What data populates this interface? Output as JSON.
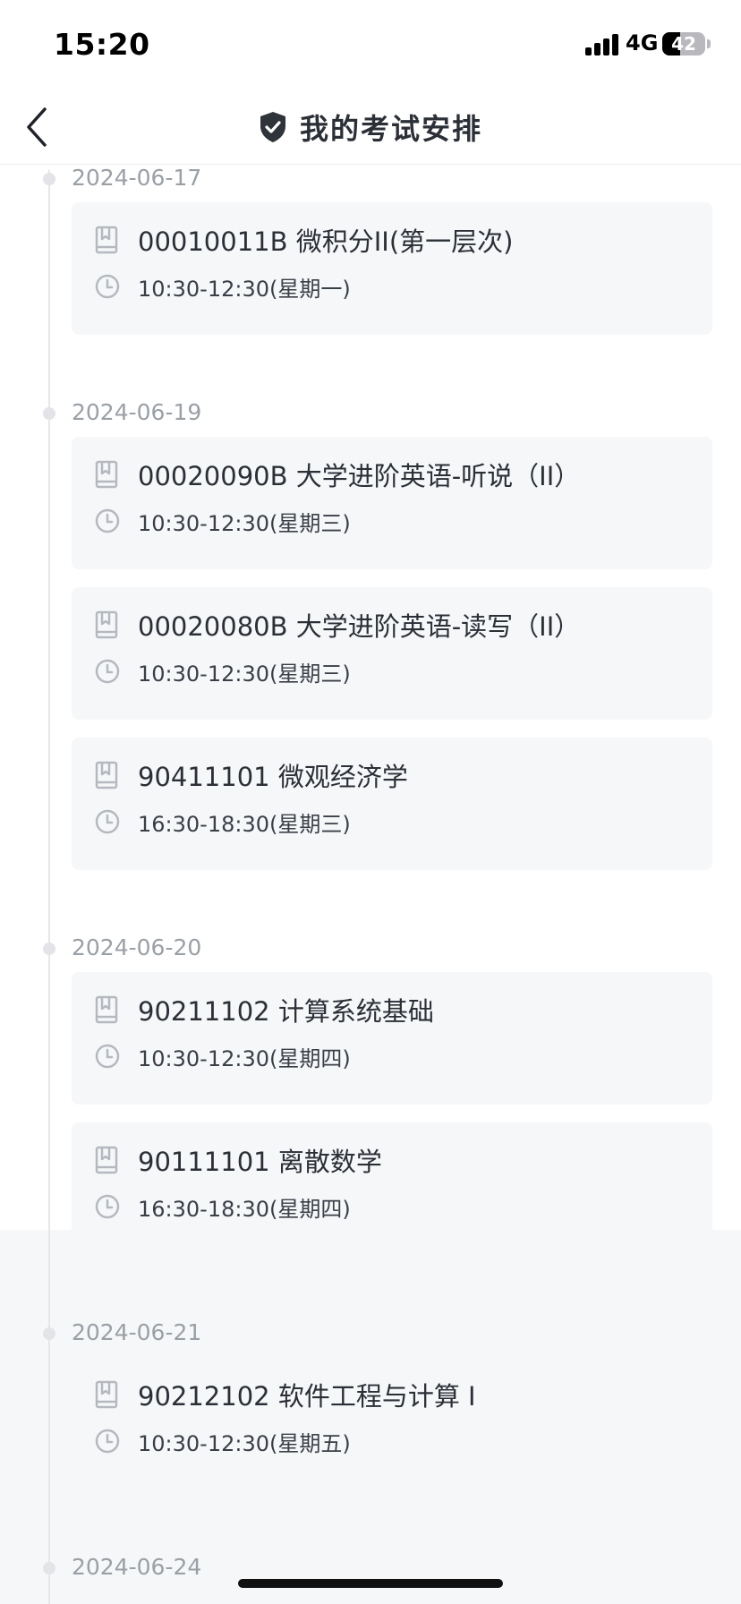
{
  "status_bar": {
    "time": "15:20",
    "network": "4G",
    "battery": "42",
    "battery_level": 0.42
  },
  "nav": {
    "title": "我的考试安排"
  },
  "groups": [
    {
      "date": "2024-06-17",
      "exams": [
        {
          "title": "00010011B 微积分II(第一层次)",
          "time": "10:30-12:30(星期一)"
        }
      ]
    },
    {
      "date": "2024-06-19",
      "exams": [
        {
          "title": "00020090B 大学进阶英语-听说（II）",
          "time": "10:30-12:30(星期三)"
        },
        {
          "title": "00020080B 大学进阶英语-读写（II）",
          "time": "10:30-12:30(星期三)"
        },
        {
          "title": "90411101 微观经济学",
          "time": "16:30-18:30(星期三)"
        }
      ]
    },
    {
      "date": "2024-06-20",
      "exams": [
        {
          "title": "90211102 计算系统基础",
          "time": "10:30-12:30(星期四)"
        },
        {
          "title": "90111101 离散数学",
          "time": "16:30-18:30(星期四)"
        }
      ]
    },
    {
      "date": "2024-06-21",
      "exams": [
        {
          "title": "90212102 软件工程与计算 I",
          "time": "10:30-12:30(星期五)"
        }
      ]
    },
    {
      "date": "2024-06-24",
      "exams": []
    }
  ],
  "icons": {
    "back": "chevron-left-icon",
    "nav": "shield-check-icon",
    "course": "book-icon",
    "time": "clock-icon"
  },
  "colors": {
    "card_bg": "#f6f7f9",
    "date_text": "#9aa0a6",
    "title_text": "#2b2f36"
  }
}
